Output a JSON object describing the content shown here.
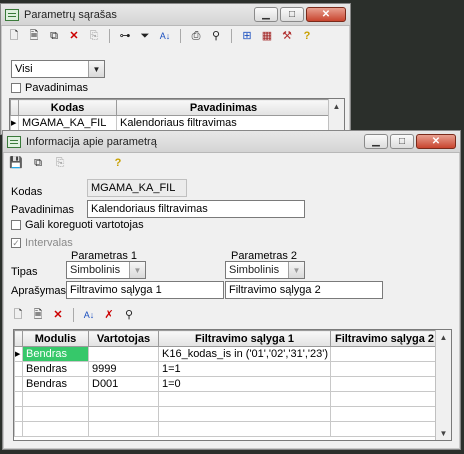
{
  "back_window": {
    "title": "Parametrų sąrašas",
    "filter_value": "Visi",
    "checkbox_label": "Pavadinimas",
    "columns": [
      "Kodas",
      "Pavadinimas"
    ],
    "rows": [
      {
        "kodas": "MGAMA_KA_FIL",
        "pavadinimas": "Kalendoriaus filtravimas"
      }
    ]
  },
  "front_window": {
    "title": "Informacija apie parametrą",
    "labels": {
      "kodas": "Kodas",
      "pavadinimas": "Pavadinimas",
      "gali_koreguoti": "Gali koreguoti vartotojas",
      "intervalas": "Intervalas",
      "parametras1": "Parametras 1",
      "parametras2": "Parametras 2",
      "tipas": "Tipas",
      "aprasymas": "Aprašymas"
    },
    "values": {
      "kodas": "MGAMA_KA_FIL",
      "pavadinimas": "Kalendoriaus filtravimas",
      "tipas1": "Simbolinis",
      "tipas2": "Simbolinis",
      "aprasymas1": "Filtravimo sąlyga 1",
      "aprasymas2": "Filtravimo sąlyga 2"
    },
    "grid": {
      "columns": [
        "Modulis",
        "Vartotojas",
        "Filtravimo sąlyga 1",
        "Filtravimo sąlyga 2"
      ],
      "rows": [
        {
          "modulis": "Bendras",
          "vartotojas": "",
          "salyga1": "K16_kodas_is in ('01','02','31','23')",
          "salyga2": ""
        },
        {
          "modulis": "Bendras",
          "vartotojas": "9999",
          "salyga1": "1=1",
          "salyga2": ""
        },
        {
          "modulis": "Bendras",
          "vartotojas": "D001",
          "salyga1": "1=0",
          "salyga2": ""
        }
      ]
    }
  },
  "icons": {
    "window_minimize": "minimize-icon",
    "window_maximize": "maximize-icon",
    "window_close": "close-icon"
  }
}
